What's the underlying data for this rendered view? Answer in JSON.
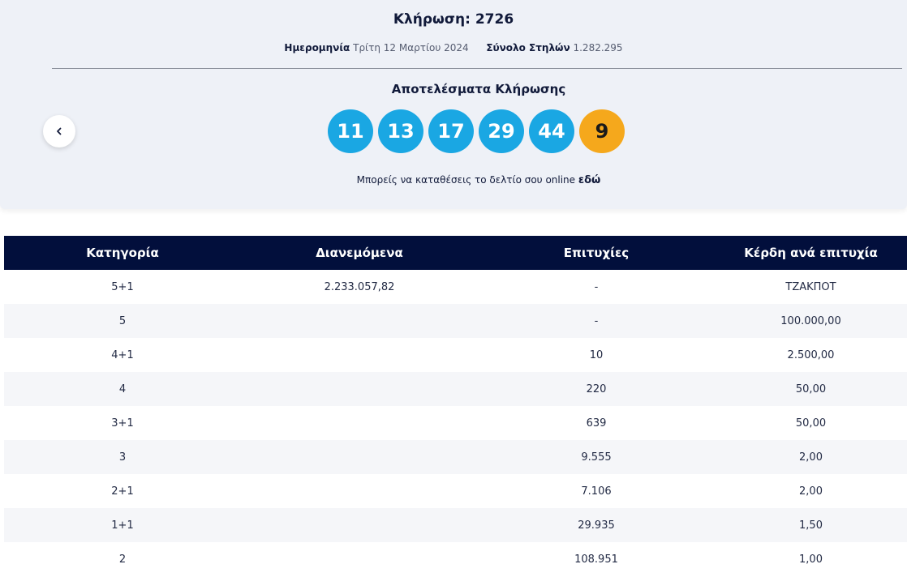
{
  "draw": {
    "title": "Κλήρωση: 2726",
    "date_label": "Ημερομηνία",
    "date_value": "Τρίτη 12 Μαρτίου 2024",
    "columns_label": "Σύνολο Στηλών",
    "columns_value": "1.282.295"
  },
  "results": {
    "title": "Αποτελέσματα Κλήρωσης",
    "main_numbers": [
      "11",
      "13",
      "17",
      "29",
      "44"
    ],
    "bonus_number": "9",
    "online_text": "Μπορείς να καταθέσεις το δελτίο σου online",
    "online_link": "εδώ"
  },
  "colors": {
    "main_ball": "#1aa7e3",
    "bonus_ball": "#f5a81c",
    "table_header": "#020f3c"
  },
  "table": {
    "headers": [
      "Κατηγορία",
      "Διανεμόμενα",
      "Επιτυχίες",
      "Κέρδη ανά επιτυχία"
    ],
    "rows": [
      [
        "5+1",
        "2.233.057,82",
        "-",
        "ΤΖΑΚΠΟΤ"
      ],
      [
        "5",
        "",
        "-",
        "100.000,00"
      ],
      [
        "4+1",
        "",
        "10",
        "2.500,00"
      ],
      [
        "4",
        "",
        "220",
        "50,00"
      ],
      [
        "3+1",
        "",
        "639",
        "50,00"
      ],
      [
        "3",
        "",
        "9.555",
        "2,00"
      ],
      [
        "2+1",
        "",
        "7.106",
        "2,00"
      ],
      [
        "1+1",
        "",
        "29.935",
        "1,50"
      ],
      [
        "2",
        "",
        "108.951",
        "1,00"
      ]
    ]
  }
}
